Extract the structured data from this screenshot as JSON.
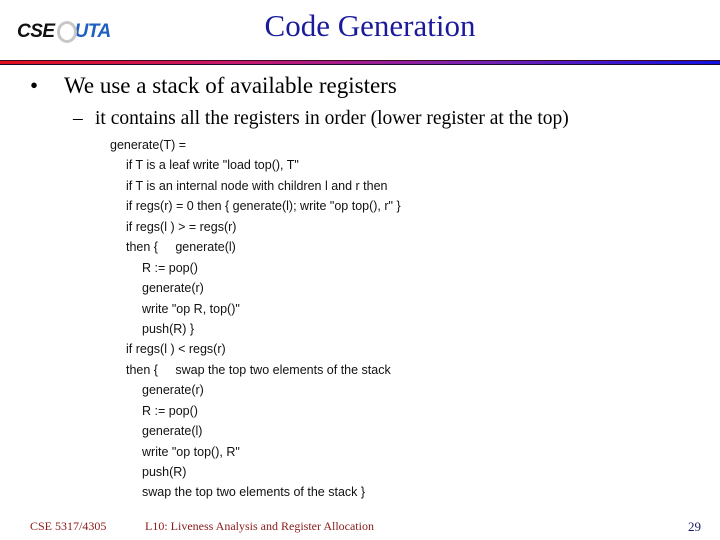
{
  "header": {
    "logo": {
      "left": "CSE",
      "right": "UTA"
    },
    "title": "Code Generation"
  },
  "body": {
    "bullet": "We use a stack of available registers",
    "sub_bullet": "it contains all the registers in order (lower register at the top)",
    "code_lines": [
      {
        "indent": 0,
        "text": "generate(T) ="
      },
      {
        "indent": 1,
        "text": "if T is a leaf write \"load top(), T\""
      },
      {
        "indent": 1,
        "text": "if T is an internal node with children l and r then"
      },
      {
        "indent": 1,
        "text": "if regs(r) = 0 then { generate(l); write \"op top(), r\" }"
      },
      {
        "indent": 1,
        "text": "if regs(l ) > = regs(r)"
      },
      {
        "indent": 1,
        "text": "then {     generate(l)"
      },
      {
        "indent": 2,
        "text": "R := pop()"
      },
      {
        "indent": 2,
        "text": "generate(r)"
      },
      {
        "indent": 2,
        "text": "write \"op R, top()\""
      },
      {
        "indent": 2,
        "text": "push(R) }"
      },
      {
        "indent": 1,
        "text": "if regs(l ) < regs(r)"
      },
      {
        "indent": 1,
        "text": "then {     swap the top two elements of the stack"
      },
      {
        "indent": 2,
        "text": "generate(r)"
      },
      {
        "indent": 2,
        "text": "R := pop()"
      },
      {
        "indent": 2,
        "text": "generate(l)"
      },
      {
        "indent": 2,
        "text": "write \"op top(), R\""
      },
      {
        "indent": 2,
        "text": "push(R)"
      },
      {
        "indent": 2,
        "text": "swap the top two elements of the stack }"
      }
    ]
  },
  "footer": {
    "course": "CSE 5317/4305",
    "lecture": "L10: Liveness Analysis and Register Allocation",
    "page_number": "29"
  },
  "colors": {
    "title": "#1a1a9a",
    "footer_text": "#8a1a1a",
    "page_number": "#1a1a6a",
    "rule_start": "#e0101a",
    "rule_end": "#1010e0"
  }
}
